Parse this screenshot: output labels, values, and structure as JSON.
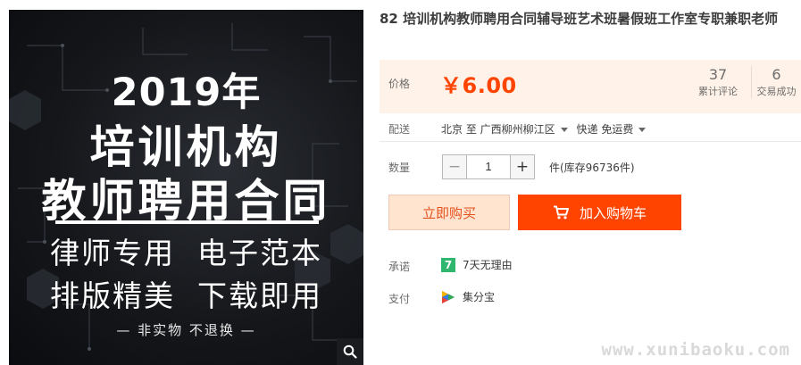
{
  "gallery": {
    "cover": {
      "year": "2019年",
      "line1": "培训机构",
      "line2": "教师聘用合同",
      "sub1": "律师专用  电子范本",
      "sub2": "排版精美  下载即用",
      "note": "— 非实物 不退换 —"
    },
    "zoom_icon": "magnifier-icon"
  },
  "product": {
    "title": "82 培训机构教师聘用合同辅导班艺术班暑假班工作室专职兼职老师"
  },
  "price": {
    "label": "价格",
    "value": "￥6.00",
    "reviews_count": "37",
    "reviews_label": "累计评论",
    "sales_count": "6",
    "sales_label": "交易成功"
  },
  "shipping": {
    "label": "配送",
    "from": "北京 至",
    "to": "广西柳州柳江区",
    "method": "快递 免运费"
  },
  "quantity": {
    "label": "数量",
    "minus": "−",
    "value": "1",
    "plus": "+",
    "stock": "件(库存96736件)"
  },
  "actions": {
    "buy_now": "立即购买",
    "add_to_cart": "加入购物车"
  },
  "promise": {
    "label": "承诺",
    "badge": "7",
    "text": "7天无理由"
  },
  "payment": {
    "label": "支付",
    "text": "集分宝"
  },
  "watermark": "www.xunibaoku.com",
  "colors": {
    "accent": "#ff4400",
    "price_bg": "#fff2e8",
    "buy_now_bg": "#ffe4d0",
    "promise_green": "#2fb76f"
  }
}
